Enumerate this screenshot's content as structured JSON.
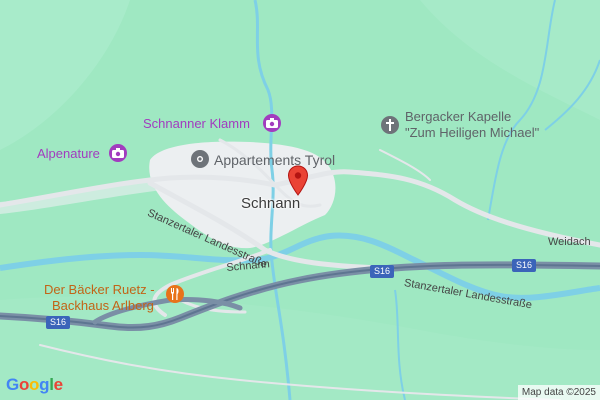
{
  "map": {
    "town_label": "Schnann",
    "places": {
      "klamm": "Schnanner Klamm",
      "alpenature": "Alpenature",
      "appartements": "Appartements Tyrol",
      "kapelle_line1": "Bergacker Kapelle",
      "kapelle_line2": "\"Zum Heiligen Michael\"",
      "baecker_line1": "Der Bäcker Ruetz -",
      "baecker_line2": "Backhaus Arlberg"
    },
    "roads": {
      "landesstrasse_upper": "Stanzertaler Landesstraße",
      "landesstrasse_lower": "Stanzertaler Landesstraße",
      "schnann_road": "Schnann",
      "weidach": "Weidach",
      "shield_s16": "S16"
    },
    "attribution": "Map data ©2025",
    "logo": [
      "G",
      "o",
      "o",
      "g",
      "l",
      "e"
    ],
    "colors": {
      "land": "#9fe8c2",
      "water": "#7ed0e6",
      "settlement": "#eceff1",
      "highway": "#7a8fa6",
      "marker": "#ea4335",
      "poi_purple": "#a23cbf",
      "poi_orange": "#e8731a",
      "poi_gray": "#6e7379"
    },
    "icons": {
      "klamm": "camera-icon",
      "alpenature": "camera-icon",
      "appartements": "hotel-dot-icon",
      "kapelle": "cross-icon",
      "baecker": "restaurant-icon",
      "marker": "map-pin-icon"
    }
  }
}
